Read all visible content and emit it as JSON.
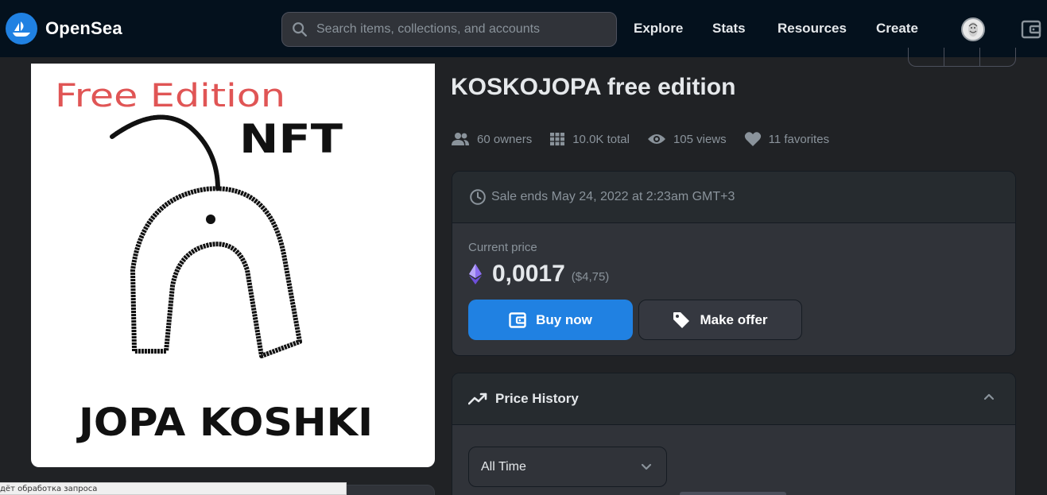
{
  "navbar": {
    "brand": "OpenSea",
    "search_placeholder": "Search items, collections, and accounts",
    "links": [
      "Explore",
      "Stats",
      "Resources",
      "Create"
    ]
  },
  "artwork": {
    "lines": [
      "Free Edition",
      "NFT",
      "JOPA KOSHKI"
    ]
  },
  "item": {
    "title": "KOSKOJOPA free edition",
    "stats": {
      "owners": "60 owners",
      "total": "10.0K total",
      "views": "105 views",
      "favorites": "11 favorites"
    }
  },
  "sale": {
    "ends": "Sale ends May 24, 2022 at 2:23am GMT+3",
    "price_label": "Current price",
    "price": "0,0017",
    "price_usd": "($4,75)",
    "buy_label": "Buy now",
    "offer_label": "Make offer"
  },
  "history": {
    "title": "Price History",
    "range_selected": "All Time"
  },
  "browser_status": "дёт обработка запроса",
  "colors": {
    "accent": "#2081e2",
    "navbar_bg": "#04111d",
    "page_bg": "#202225",
    "card_bg": "#303339",
    "eth": "#8c6ef0"
  }
}
